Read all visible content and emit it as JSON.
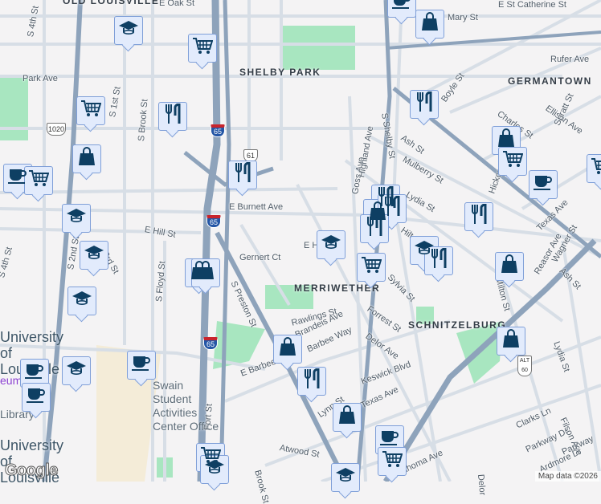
{
  "map": {
    "neighborhoods": [
      "OLD LOUISVILLE",
      "SHELBY PARK",
      "GERMANTOWN",
      "MERRIWETHER",
      "SCHNITZELBURG"
    ],
    "places": {
      "university_1": "University of Louisville",
      "university_2": "University of Louisville",
      "swain": "Swain Student Activities Center Office",
      "library": "Library",
      "museum": "eum"
    },
    "streets": [
      "E Oak St",
      "Park Ave",
      "S 4th St",
      "S 1st St",
      "S Brook St",
      "S Floyd St",
      "S 2nd St",
      "S 3rd St",
      "S 4th St",
      "E Hill St",
      "E Burnett Ave",
      "Gernert Ct",
      "S Preston St",
      "Rawlings St",
      "Brandeis Ave",
      "Barbee Way",
      "E Barbee Ave",
      "Fort St",
      "Lynn St",
      "Atwood St",
      "S Shelby St",
      "Ash St",
      "Mulberry St",
      "Lydia St",
      "Boyle St",
      "Charles St",
      "Ellison Ave",
      "Spratt St",
      "Rufer Ave",
      "Hickory St",
      "Texas Ave",
      "Wagner St",
      "Reasor Ave",
      "Ash St",
      "Milton St",
      "Sylvia St",
      "Forrest St",
      "Delor Ave",
      "Keswick Blvd",
      "Texas Ave",
      "Clarks Ln",
      "Parkway Dr",
      "Ardmore Dr",
      "Filson Ave",
      "Lydia St",
      "Oklahoma Ave",
      "E Hill St",
      "Hilton St",
      "Goss Ave",
      "Mary St",
      "E St Catherine St",
      "Highland Ave",
      "Brook St",
      "Delor",
      "Parkway"
    ],
    "shields": [
      "65",
      "65",
      "65",
      "1020",
      "61",
      "ALT 60"
    ],
    "attribution": "Map data ©2026",
    "logo": "Google"
  },
  "markers": [
    "coffee",
    "shopping",
    "school",
    "grocery",
    "grocery",
    "restaurant",
    "shopping",
    "coffee",
    "grocery",
    "restaurant",
    "restaurant",
    "shopping",
    "grocery",
    "grocery",
    "coffee",
    "restaurant",
    "shopping",
    "restaurant",
    "school",
    "restaurant",
    "restaurant",
    "school",
    "school",
    "school",
    "restaurant",
    "grocery",
    "shopping",
    "shopping",
    "shopping",
    "school",
    "shopping",
    "coffee",
    "school",
    "coffee",
    "coffee",
    "shopping",
    "restaurant",
    "shopping",
    "coffee",
    "grocery",
    "grocery",
    "school",
    "school"
  ],
  "colors": {
    "marker_bg": "#e2ebfc",
    "marker_border": "#7f9fd8",
    "icon": "#0e3f63",
    "highway": "#8ea3bb",
    "park": "#a8e6c0",
    "campus": "#f4ecd8"
  }
}
